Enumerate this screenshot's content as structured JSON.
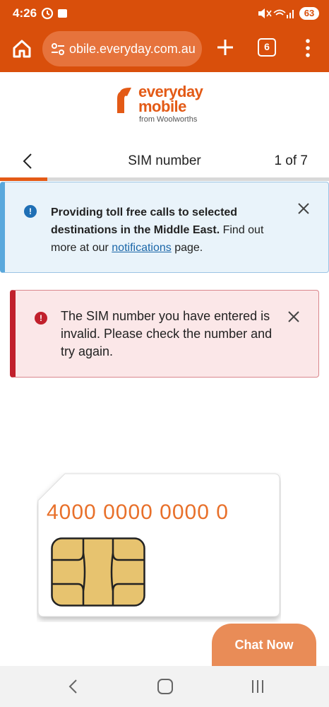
{
  "status": {
    "time": "4:26",
    "battery": "63"
  },
  "browser": {
    "url": "obile.everyday.com.au",
    "tab_count": "6"
  },
  "logo": {
    "line1": "everyday",
    "line2": "mobile",
    "line3": "from Woolworths"
  },
  "nav": {
    "title": "SIM number",
    "step": "1 of 7",
    "progress_fraction": 0.1429
  },
  "info_banner": {
    "bold_text": "Providing toll free calls to selected destinations in the Middle East.",
    "text_before_link": " Find out more at our ",
    "link_text": "notifications",
    "text_after_link": " page."
  },
  "error_banner": {
    "message": "The SIM number you have entered is invalid. Please check the number and try again."
  },
  "sim_card": {
    "number": "4000 0000 0000 0"
  },
  "chat": {
    "label": "Chat Now"
  },
  "colors": {
    "brand_orange": "#e35a16",
    "statusbar": "#d94f0b",
    "info_accent": "#5aa8dc",
    "error_accent": "#c1202c"
  }
}
